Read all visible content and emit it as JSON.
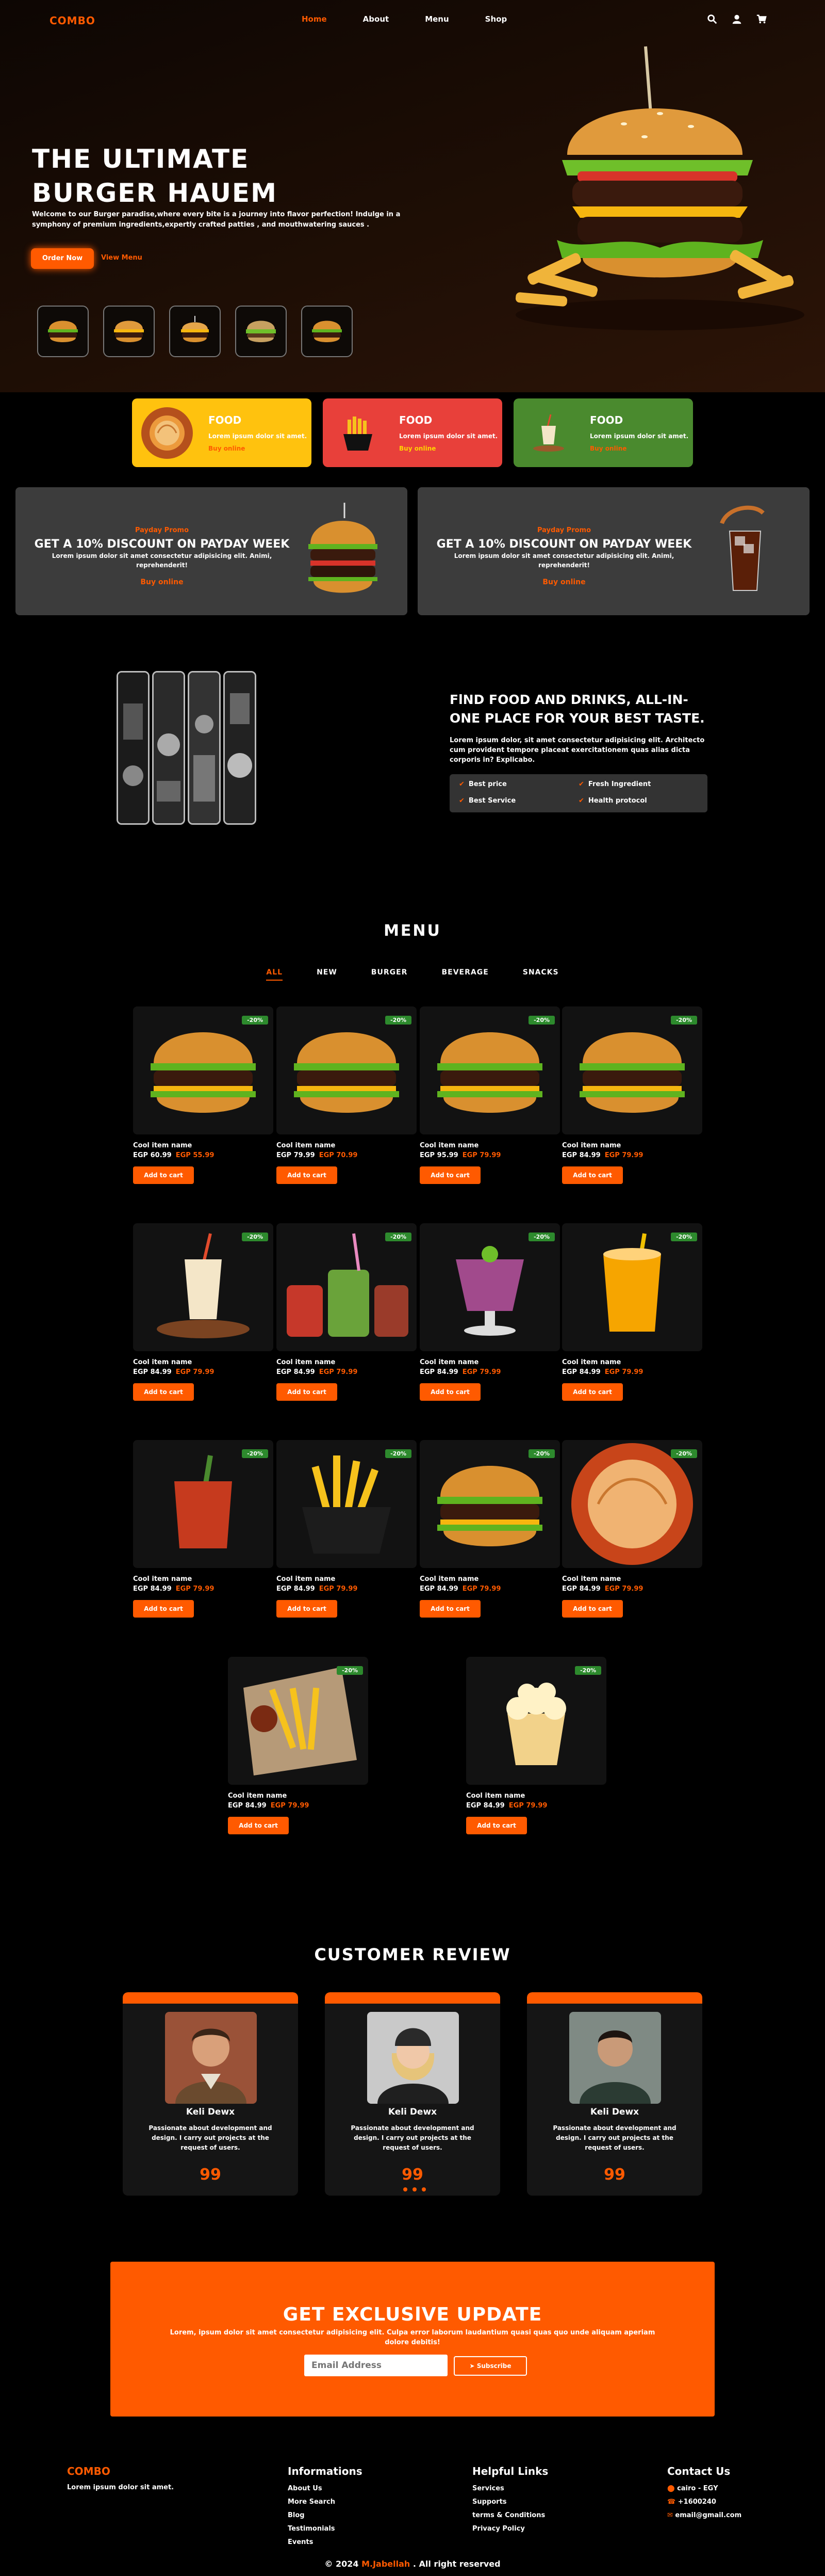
{
  "header": {
    "logo": "COMBO",
    "nav": [
      "Home",
      "About",
      "Menu",
      "Shop"
    ],
    "active_nav": "Home",
    "icons": [
      "search-icon",
      "user-icon",
      "cart-icon"
    ]
  },
  "hero": {
    "title_line1": "THE ULTIMATE",
    "title_line2": "BURGER HAUEM",
    "description": "Welcome to our Burger paradise,where every bite is a journey into flavor perfection! Indulge in a symphony of premium ingredients,expertly crafted patties , and mouthwatering sauces .",
    "order_button": "Order Now",
    "menu_link": "View Menu",
    "accent": "#ff5a00"
  },
  "food_cards": [
    {
      "title": "FOOD",
      "text": "Lorem ipsum dolor sit amet.",
      "link": "Buy online",
      "bg": "#ffc20e",
      "link_color": "#ff5a00"
    },
    {
      "title": "FOOD",
      "text": "Lorem ipsum dolor sit amet.",
      "link": "Buy online",
      "bg": "#e8403a",
      "link_color": "#ffd400"
    },
    {
      "title": "FOOD",
      "text": "Lorem ipsum dolor sit amet.",
      "link": "Buy online",
      "bg": "#4a8a2e",
      "link_color": "#ff5a00"
    }
  ],
  "promos": [
    {
      "label": "Payday Promo",
      "title": "GET A 10% DISCOUNT ON PAYDAY WEEK",
      "text": "Lorem ipsum dolor sit amet consectetur adipisicing elit. Animi, reprehenderit!",
      "button": "Buy online"
    },
    {
      "label": "Payday Promo",
      "title": "GET A 10% DISCOUNT ON PAYDAY WEEK",
      "text": "Lorem ipsum dolor sit amet consectetur adipisicing elit. Animi, reprehenderit!",
      "button": "Buy online"
    }
  ],
  "about": {
    "title": "FlND FOOD AND DRINKS, ALL-IN-ONE PLACE FOR YOUR BEST TASTE.",
    "text": "Lorem ipsum dolor, sit amet consectetur adipisicing elit. Architecto cum provident tempore placeat exercitationem quas alias dicta corporis in? Explicabo.",
    "features": [
      "Best price",
      "Fresh Ingredient",
      "Best Service",
      "Health protocol"
    ]
  },
  "menu": {
    "title": "MENU",
    "tabs": [
      "ALL",
      "NEW",
      "BURGER",
      "BEVERAGE",
      "SNACKS"
    ],
    "active_tab": "ALL",
    "items": [
      {
        "name": "Cool item name",
        "old": "EGP 60.99",
        "new": "EGP 55.99",
        "badge": "-20%",
        "button": "Add to cart",
        "icon": "burger-icon"
      },
      {
        "name": "Cool item name",
        "old": "EGP 79.99",
        "new": "EGP 70.99",
        "badge": "-20%",
        "button": "Add to cart",
        "icon": "burger-icon"
      },
      {
        "name": "Cool item name",
        "old": "EGP 95.99",
        "new": "EGP 79.99",
        "badge": "-20%",
        "button": "Add to cart",
        "icon": "burger-icon"
      },
      {
        "name": "Cool item name",
        "old": "EGP 84.99",
        "new": "EGP 79.99",
        "badge": "-20%",
        "button": "Add to cart",
        "icon": "burger-icon"
      },
      {
        "name": "Cool item name",
        "old": "EGP 84.99",
        "new": "EGP 79.99",
        "badge": "-20%",
        "button": "Add to cart",
        "icon": "milkshake-icon"
      },
      {
        "name": "Cool item name",
        "old": "EGP 84.99",
        "new": "EGP 79.99",
        "badge": "-20%",
        "button": "Add to cart",
        "icon": "jars-icon"
      },
      {
        "name": "Cool item name",
        "old": "EGP 84.99",
        "new": "EGP 79.99",
        "badge": "-20%",
        "button": "Add to cart",
        "icon": "smoothie-icon"
      },
      {
        "name": "Cool item name",
        "old": "EGP 84.99",
        "new": "EGP 79.99",
        "badge": "-20%",
        "button": "Add to cart",
        "icon": "juice-icon"
      },
      {
        "name": "Cool item name",
        "old": "EGP 84.99",
        "new": "EGP 79.99",
        "badge": "-20%",
        "button": "Add to cart",
        "icon": "drink-icon"
      },
      {
        "name": "Cool item name",
        "old": "EGP 84.99",
        "new": "EGP 79.99",
        "badge": "-20%",
        "button": "Add to cart",
        "icon": "fries-bowl-icon"
      },
      {
        "name": "Cool item name",
        "old": "EGP 84.99",
        "new": "EGP 79.99",
        "badge": "-20%",
        "button": "Add to cart",
        "icon": "burger-icon"
      },
      {
        "name": "Cool item name",
        "old": "EGP 84.99",
        "new": "EGP 79.99",
        "badge": "-20%",
        "button": "Add to cart",
        "icon": "dumpling-icon"
      },
      {
        "name": "Cool item name",
        "old": "EGP 84.99",
        "new": "EGP 79.99",
        "badge": "-20%",
        "button": "Add to cart",
        "icon": "fries-icon"
      },
      {
        "name": "Cool item name",
        "old": "EGP 84.99",
        "new": "EGP 79.99",
        "badge": "-20%",
        "button": "Add to cart",
        "icon": "popcorn-icon"
      }
    ]
  },
  "reviews": {
    "title": "CUSTOMER REVIEW",
    "items": [
      {
        "name": "Keli Dewx",
        "text": "Passionate about development and design. I carry out projects at the request of users."
      },
      {
        "name": "Keli Dewx",
        "text": "Passionate about development and design. I carry out projects at the request of users."
      },
      {
        "name": "Keli Dewx",
        "text": "Passionate about development and design. I carry out projects at the request of users."
      }
    ],
    "quote": "99"
  },
  "newsletter": {
    "title": "GET EXCLUSlVE UPDATE",
    "text": "Lorem, ipsum dolor sit amet consectetur adipisicing elit. Culpa error laborum laudantium quasi quas quo unde aliquam aperiam dolore debitis!",
    "placeholder": "Email Address",
    "button": "Subscribe"
  },
  "footer": {
    "logo": "COMBO",
    "tagline": "Lorem ipsum dolor sit amet.",
    "info_title": "Informations",
    "info_links": [
      "About Us",
      "More Search",
      "Blog",
      "Testimonials",
      "Events"
    ],
    "help_title": "Helpful Links",
    "help_links": [
      "Services",
      "Supports",
      "terms & Conditions",
      "Privacy Policy"
    ],
    "contact_title": "Contact Us",
    "contact": [
      "cairo - EGY",
      "+1600240",
      "email@gmail.com"
    ],
    "copyright_pre": "© 2024",
    "copyright_name": "M.Jabellah",
    "copyright_post": ". All right reserved"
  }
}
